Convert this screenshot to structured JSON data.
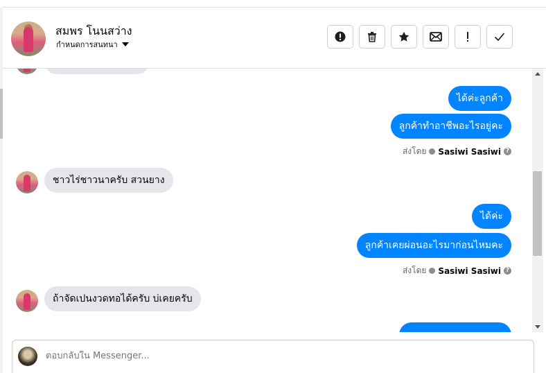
{
  "header": {
    "contact_name": "สมพร โนนสว่าง",
    "assign_label": "กำหนดการสนทนา",
    "actions": [
      {
        "name": "report-button",
        "icon": "alert-circle-icon"
      },
      {
        "name": "delete-button",
        "icon": "trash-icon"
      },
      {
        "name": "star-button",
        "icon": "star-icon"
      },
      {
        "name": "mark-unread-button",
        "icon": "envelope-icon"
      },
      {
        "name": "spam-button",
        "icon": "exclamation-icon"
      },
      {
        "name": "done-button",
        "icon": "check-icon"
      }
    ]
  },
  "messages": {
    "m1": "ได้ค่ะลูกค้า",
    "m2": "ลูกค้าทำอาชีพอะไรอยู่คะ",
    "m3": "ชาวไร่ชาวนาครับ สวนยาง",
    "m4": "ได้ค่ะ",
    "m5": "ลูกค้าเคยผ่อนอะไรมาก่อนไหมคะ",
    "m6": "ถ้าจัดเปนงวดทอได้ครับ  บ่เคยครับ"
  },
  "sent_by": {
    "label": "ส่งโดย",
    "name": "Sasiwi Sasiwi",
    "help": "?"
  },
  "composer": {
    "placeholder": "ตอบกลับใน Messenger..."
  },
  "colors": {
    "outgoing_bubble": "#0084ff",
    "incoming_bubble": "#e4e6eb"
  }
}
